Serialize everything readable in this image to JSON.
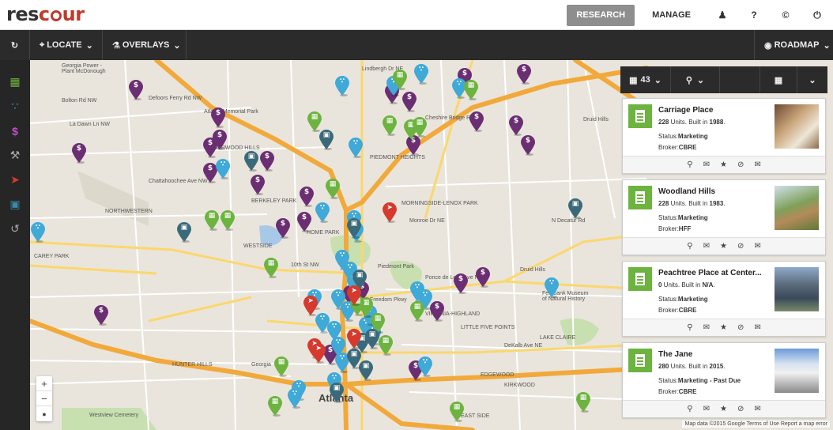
{
  "topbar": {
    "logo_part1": "res",
    "logo_part2": "c",
    "logo_part3": "ur",
    "research_label": "RESEARCH",
    "manage_label": "MANAGE"
  },
  "toolbar": {
    "locate_label": "LOCATE",
    "overlays_label": "OVERLAYS",
    "roadmap_label": "ROADMAP"
  },
  "panel": {
    "count": "43"
  },
  "map": {
    "labels": [
      "Georgia Power -\nPlant McDonough",
      "Bolton Rd NW",
      "La Dawn Ln NW",
      "Defoors Ferry Rd NW",
      "Atlanta Memorial Park",
      "UNDERWOOD HILLS",
      "Chattahoochee Ave NW",
      "Lindbergh Dr NE",
      "Cheshire Bridge Rd NE",
      "Druid Hills",
      "PIEDMONT HEIGHTS",
      "NORTHWESTERN",
      "BERKELEY PARK",
      "MORNINGSIDE-LENOX PARK",
      "CAREY PARK",
      "WESTSIDE",
      "HOME PARK",
      "Piedmont Park",
      "10th St NW",
      "Druid Hills",
      "Fernbank Museum\nof Natural History",
      "VIRGINIA-HIGHLAND",
      "LITTLE FIVE POINTS",
      "LAKE CLAIRE",
      "HUNTER HILLS",
      "Georgia",
      "EDGEWOOD",
      "KIRKWOOD",
      "Westview Cemetery",
      "EAST SIDE",
      "Atlanta",
      "Ponce de Leon Ave NE",
      "DeKalb Ave NE",
      "N Decatur Rd",
      "Monroe Dr NE",
      "Freedom Pkwy"
    ],
    "attribution": "Map data ©2015 Google   Terms of Use   Report a map error"
  },
  "cards": [
    {
      "name": "Carriage Place",
      "units": "228",
      "units_suffix": " Units. Built in ",
      "year": "1988",
      "status_label": "Status:",
      "status": "Marketing",
      "broker_label": "Broker:",
      "broker": "CBRE"
    },
    {
      "name": "Woodland Hills",
      "units": "228",
      "units_suffix": " Units. Built in ",
      "year": "1983",
      "status_label": "Status:",
      "status": "Marketing",
      "broker_label": "Broker:",
      "broker": "HFF"
    },
    {
      "name": "Peachtree Place at Center...",
      "units": "0",
      "units_suffix": " Units. Built in ",
      "year": "N/A",
      "status_label": "Status:",
      "status": "Marketing",
      "broker_label": "Broker:",
      "broker": "CBRE"
    },
    {
      "name": "The Jane",
      "units": "280",
      "units_suffix": " Units. Built in ",
      "year": "2015",
      "status_label": "Status:",
      "status": "Marketing - Past Due",
      "broker_label": "Broker:",
      "broker": "CBRE"
    }
  ],
  "colors": {
    "purple": "#6b2e73",
    "green": "#6db33f",
    "blue": "#3fa9d8",
    "teal": "#3a6a7a",
    "red": "#d63a2e",
    "highway": "#f2a93b",
    "road": "#fbd76d"
  },
  "icons": {
    "refresh": "refresh-icon",
    "user": "user-icon",
    "help": "help-icon",
    "copyright": "copyright-icon",
    "power": "power-icon"
  }
}
